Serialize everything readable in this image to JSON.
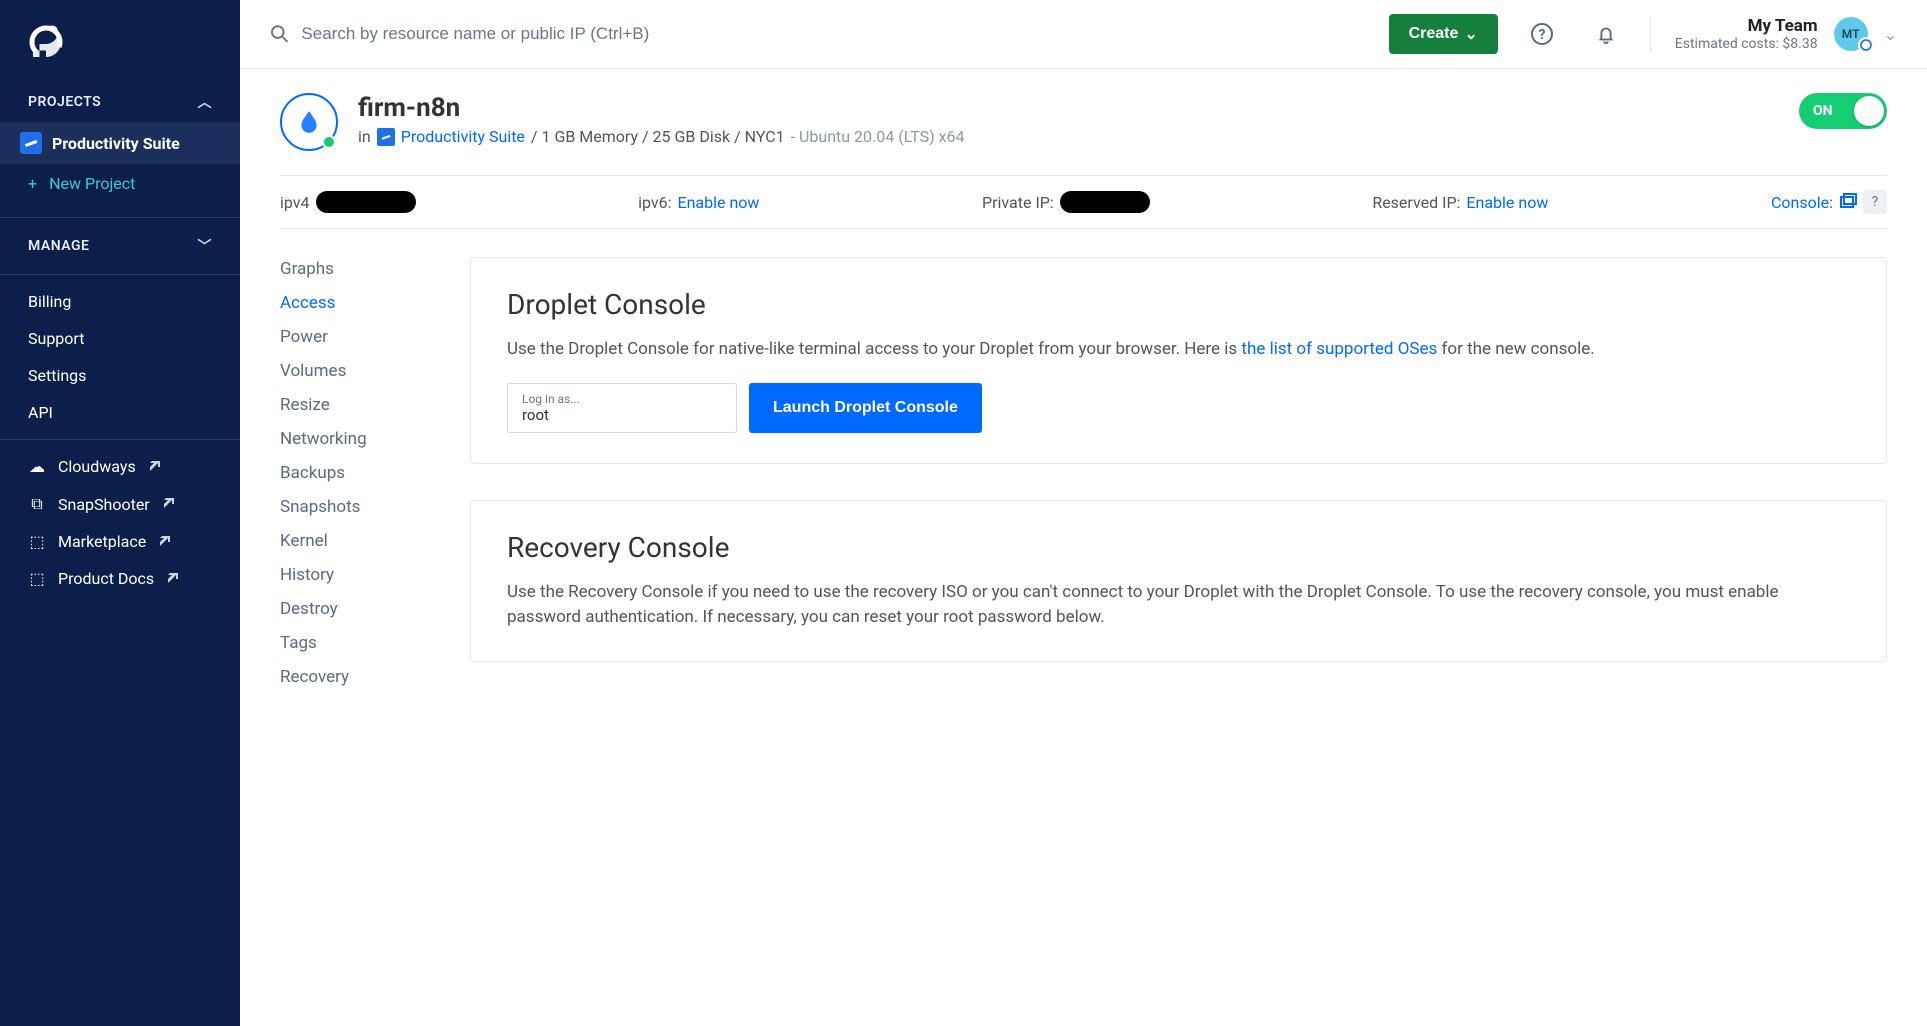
{
  "sidebar": {
    "projects_label": "PROJECTS",
    "active_project": "Productivity Suite",
    "new_project": "New Project",
    "manage_label": "MANAGE",
    "links": {
      "billing": "Billing",
      "support": "Support",
      "settings": "Settings",
      "api": "API"
    },
    "ext_links": {
      "cloudways": "Cloudways",
      "snapshooter": "SnapShooter",
      "marketplace": "Marketplace",
      "product_docs": "Product Docs"
    }
  },
  "topbar": {
    "search_placeholder": "Search by resource name or public IP (Ctrl+B)",
    "create": "Create",
    "team_name": "My Team",
    "team_cost": "Estimated costs: $8.38",
    "avatar_initials": "MT"
  },
  "droplet": {
    "name": "firm-n8n",
    "in_prefix": "in",
    "project_link": "Productivity Suite",
    "specs": "/ 1 GB Memory / 25 GB Disk / NYC1",
    "os": "- Ubuntu 20.04 (LTS) x64",
    "toggle": "ON"
  },
  "ipbar": {
    "ipv4_label": "ipv4",
    "ipv6_label": "ipv6:",
    "ipv6_link": "Enable now",
    "private_label": "Private IP:",
    "reserved_label": "Reserved IP:",
    "reserved_link": "Enable now",
    "console_label": "Console:",
    "help": "?"
  },
  "tabs": {
    "graphs": "Graphs",
    "access": "Access",
    "power": "Power",
    "volumes": "Volumes",
    "resize": "Resize",
    "networking": "Networking",
    "backups": "Backups",
    "snapshots": "Snapshots",
    "kernel": "Kernel",
    "history": "History",
    "destroy": "Destroy",
    "tags": "Tags",
    "recovery": "Recovery"
  },
  "console_panel": {
    "title": "Droplet Console",
    "desc_pre": "Use the Droplet Console for native-like terminal access to your Droplet from your browser. Here is ",
    "desc_link": "the list of supported OSes",
    "desc_post": " for the new console.",
    "login_label": "Log in as...",
    "login_value": "root",
    "launch": "Launch Droplet Console"
  },
  "recovery_panel": {
    "title": "Recovery Console",
    "desc": "Use the Recovery Console if you need to use the recovery ISO or you can't connect to your Droplet with the Droplet Console. To use the recovery console, you must enable password authentication. If necessary, you can reset your root password below."
  }
}
